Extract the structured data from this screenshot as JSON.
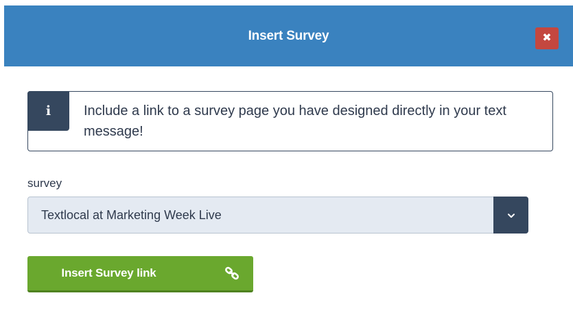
{
  "modal": {
    "title": "Insert Survey",
    "close_glyph": "✖",
    "close_icon": "close-icon"
  },
  "info": {
    "icon_glyph": "i",
    "icon": "info-icon",
    "text": "Include a link to a survey page you have designed directly in your text message!"
  },
  "survey": {
    "label": "survey",
    "selected": "Textlocal at Marketing Week Live",
    "arrow_glyph": "▼",
    "arrow_icon": "chevron-down-icon"
  },
  "insert_button": {
    "label": "Insert Survey link",
    "icon": "link-icon"
  },
  "colors": {
    "header": "#3a82bf",
    "close": "#c4473f",
    "dark_navy": "#35475e",
    "select_bg": "#e4eaf2",
    "button_green": "#6aa82e"
  }
}
